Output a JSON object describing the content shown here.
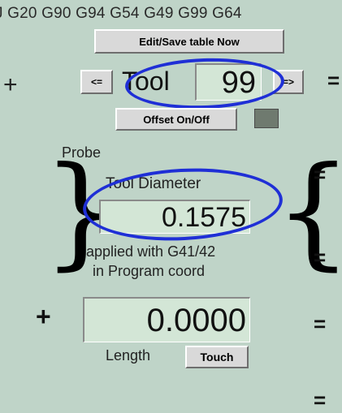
{
  "gcode_modes": "J G20 G90 G94 G54 G49 G99 G64",
  "buttons": {
    "edit_save": "Edit/Save table Now",
    "prev": "<=",
    "next": "=>",
    "offset_toggle": "Offset On/Off",
    "touch": "Touch"
  },
  "tool": {
    "label": "Tool",
    "number": "99"
  },
  "probe_label": "Probe",
  "diameter": {
    "label": "Tool Diameter",
    "value": "0.1575",
    "note_line1": "applied with G41/42",
    "note_line2": "in Program coord"
  },
  "length": {
    "value": "0.0000",
    "label": "Length",
    "plus": "+"
  },
  "equals_sign": "=",
  "plus_sign": "+",
  "colors": {
    "background": "#bfd4c8",
    "field_bg": "#d3e6d6",
    "annotation": "#1f2fd6",
    "offset_led": "#6f7a6f"
  }
}
